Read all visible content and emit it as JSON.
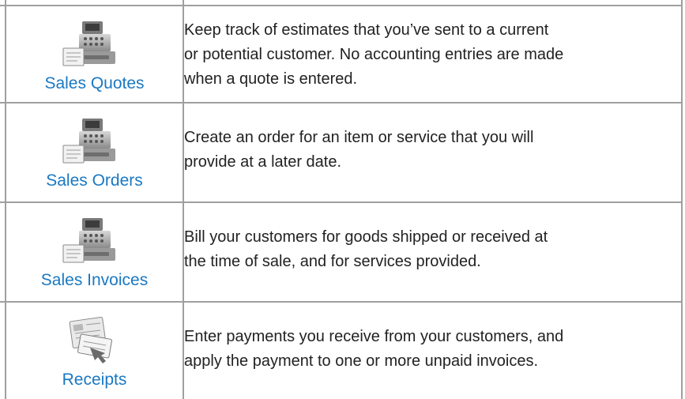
{
  "rows": [
    {
      "icon": "cash-register-icon",
      "label": "Sales Quotes",
      "description_lines": [
        "Keep track of estimates that you’ve sent to a current",
        "or potential customer. No accounting entries are made",
        "when a quote is entered."
      ]
    },
    {
      "icon": "cash-register-icon",
      "label": "Sales Orders",
      "description_lines": [
        "Create an order for an item or service that you will",
        "provide at a later date."
      ]
    },
    {
      "icon": "cash-register-icon",
      "label": "Sales Invoices",
      "description_lines": [
        "Bill your customers for goods shipped or received  at",
        "the time of sale, and for services provided."
      ]
    },
    {
      "icon": "receipt-document-icon",
      "label": "Receipts",
      "description_lines": [
        "Enter payments you receive from your customers, and",
        "apply the payment to one or more unpaid invoices."
      ]
    }
  ],
  "colors": {
    "link": "#1a78c2",
    "text": "#222222",
    "border": "#9f9f9f"
  }
}
